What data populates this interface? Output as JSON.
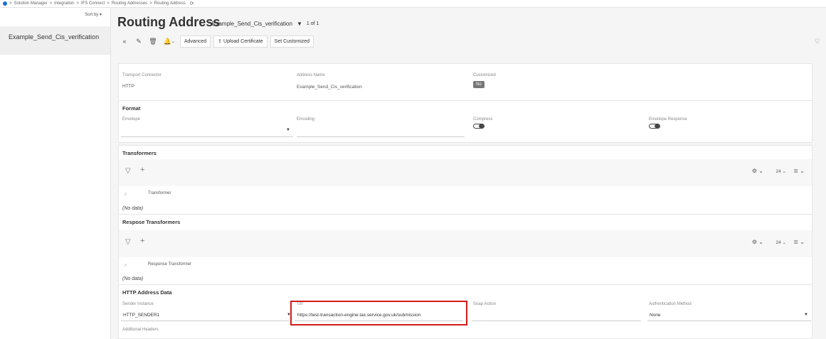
{
  "breadcrumb": {
    "items": [
      "Solution Manager",
      "Integration",
      "IFS Connect",
      "Routing Addresses",
      "Routing Address"
    ],
    "sep": ">"
  },
  "sidebar": {
    "sort_label": "Sort by",
    "items": [
      {
        "label": "Example_Send_Cis_verification"
      }
    ]
  },
  "header": {
    "title": "Routing Address",
    "record": "Example_Send_Cis_verification",
    "count": "1 of 1"
  },
  "toolbar": {
    "advanced": "Advanced",
    "upload_certificate": "Upload Certificate",
    "set_customized": "Set Customized"
  },
  "general": {
    "transport_connector_label": "Transport Connector",
    "transport_connector_value": "HTTP",
    "address_name_label": "Address Name",
    "address_name_value": "Example_Send_Cis_verification",
    "customized_label": "Customized",
    "customized_value": "No"
  },
  "format": {
    "title": "Format",
    "envelope_label": "Envelope",
    "encoding_label": "Encoding",
    "compress_label": "Compress",
    "envelope_response_label": "Envelope Response"
  },
  "transformers": {
    "title": "Transformers",
    "column": "Transformer",
    "empty": "(No data)",
    "page_size": "24"
  },
  "response_transformers": {
    "title": "Respose Transformers",
    "column": "Response Transformer",
    "empty": "(No data)",
    "page_size": "24"
  },
  "http": {
    "title": "HTTP Address Data",
    "sender_instance_label": "Sender Instance",
    "sender_instance_value": "HTTP_SENDER1",
    "url_label": "Url",
    "url_value": "https://test-transaction-engine.tax.service.gov.uk/submission",
    "soap_action_label": "Soap Action",
    "auth_method_label": "Authentication Method",
    "auth_method_value": "None",
    "additional_headers_label": "Additional Headers"
  },
  "colors": {
    "highlight": "#d31a1a",
    "accent": "#1d6fd6"
  }
}
